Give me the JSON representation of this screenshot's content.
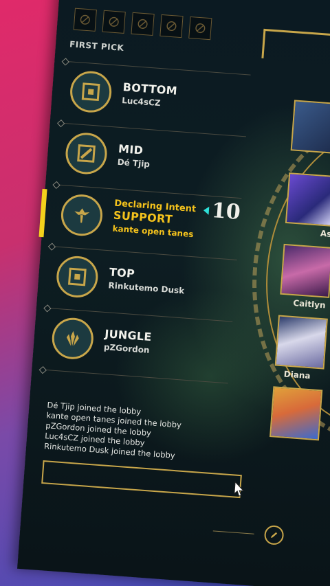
{
  "bans": {
    "slots": [
      "ban-slot-1",
      "ban-slot-2",
      "ban-slot-3",
      "ban-slot-4",
      "ban-slot-5"
    ]
  },
  "header": {
    "first_pick": "FIRST PICK"
  },
  "slots": [
    {
      "role": "BOTTOM",
      "player": "Luc4sCZ",
      "icon": "bottom-lane-icon"
    },
    {
      "role": "MID",
      "player": "Dé Tjip",
      "icon": "mid-lane-icon"
    },
    {
      "intent": "Declaring Intent",
      "role": "SUPPORT",
      "player": "kante open tanes",
      "icon": "support-icon",
      "active": true
    },
    {
      "role": "TOP",
      "player": "Rinkutemo Dusk",
      "icon": "top-lane-icon"
    },
    {
      "role": "JUNGLE",
      "player": "pZGordon",
      "icon": "jungle-icon"
    }
  ],
  "timer": {
    "value": "10"
  },
  "champions": [
    {
      "label": ""
    },
    {
      "label": "As"
    },
    {
      "label": "Caitlyn"
    },
    {
      "label": "Diana"
    },
    {
      "label": ""
    }
  ],
  "chat": {
    "messages": [
      "Dé Tjip joined the lobby",
      "kante open tanes joined the lobby",
      "pZGordon joined the lobby",
      "Luc4sCZ joined the lobby",
      "Rinkutemo Dusk joined the lobby"
    ]
  },
  "colors": {
    "gold": "#c8a64a",
    "intent_yellow": "#f4c21c",
    "timer_arrow": "#2ee0d8"
  }
}
